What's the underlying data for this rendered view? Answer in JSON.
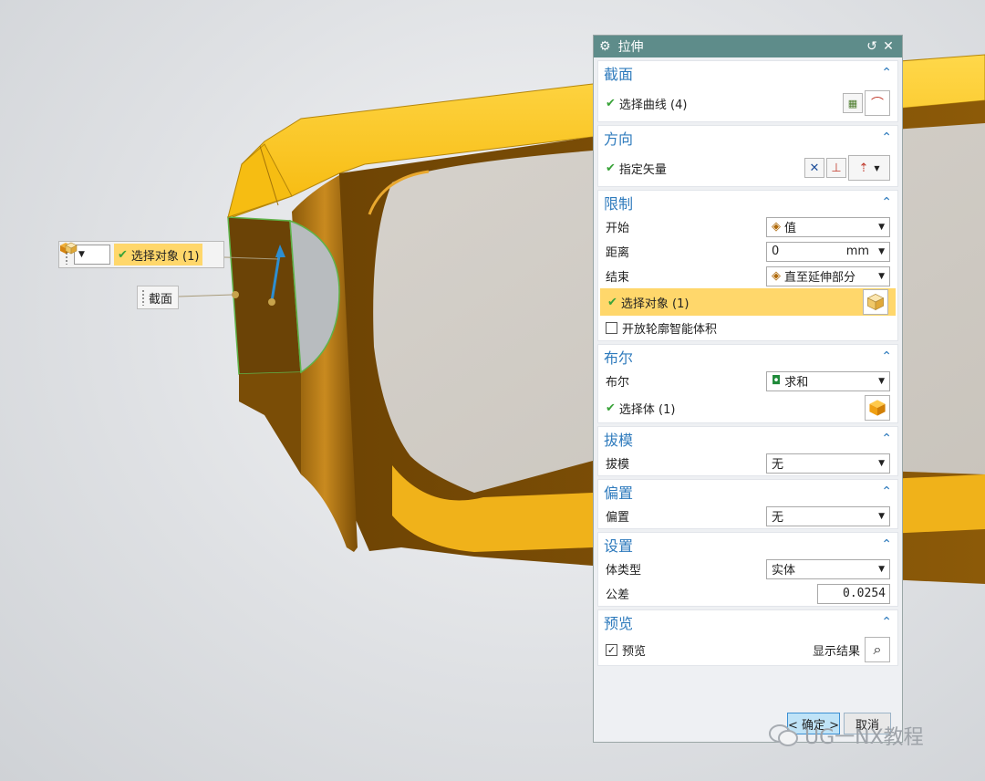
{
  "float_toolbar": {
    "select_label": "选择对象 (1)",
    "filter_value": ""
  },
  "float_label": "截面",
  "dialog": {
    "title": "拉伸",
    "sections": {
      "section": {
        "header": "截面",
        "row_label": "选择曲线 (4)"
      },
      "direction": {
        "header": "方向",
        "row_label": "指定矢量"
      },
      "limits": {
        "header": "限制",
        "start_label": "开始",
        "start_value": "值",
        "distance_label": "距离",
        "distance_value": "0",
        "distance_unit": "mm",
        "end_label": "结束",
        "end_value": "直至延伸部分",
        "select_object": "选择对象 (1)",
        "open_profile": "开放轮廓智能体积"
      },
      "boolean": {
        "header": "布尔",
        "bool_label": "布尔",
        "bool_value": "求和",
        "select_body": "选择体 (1)"
      },
      "draft": {
        "header": "拔模",
        "draft_label": "拔模",
        "draft_value": "无"
      },
      "offset": {
        "header": "偏置",
        "offset_label": "偏置",
        "offset_value": "无"
      },
      "settings": {
        "header": "设置",
        "body_type_label": "体类型",
        "body_type_value": "实体",
        "tolerance_label": "公差",
        "tolerance_value": "0.0254"
      },
      "preview": {
        "header": "预览",
        "preview_label": "预览",
        "show_result_label": "显示结果"
      }
    },
    "ok_label": "< 确定 >",
    "cancel_label": "取消"
  },
  "watermark": "UG一NX教程",
  "colors": {
    "title_bg": "#5e8c8a",
    "section_header": "#2f7bbd",
    "highlight": "#ffd76b",
    "model_orange": "#f3a50f",
    "model_brown": "#6b4306"
  }
}
